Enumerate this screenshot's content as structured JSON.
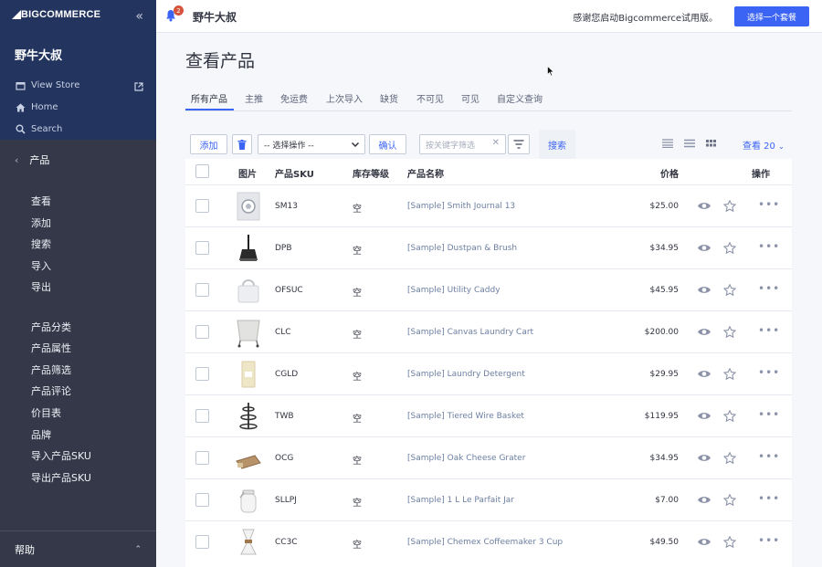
{
  "brand": {
    "logo_text": "BIGCOMMERCE",
    "accent": "#3c64f4",
    "sidebar_top": "#23355f",
    "sidebar_bg": "#343849"
  },
  "sidebar": {
    "store_name": "野牛大叔",
    "links": [
      {
        "label": "View Store",
        "icon": "storefront-icon"
      },
      {
        "label": "Home",
        "icon": "home-icon"
      },
      {
        "label": "Search",
        "icon": "search-icon"
      }
    ],
    "section": "产品",
    "items": [
      "查看",
      "添加",
      "搜索",
      "导入",
      "导出"
    ],
    "items2": [
      "产品分类",
      "产品属性",
      "产品筛选",
      "产品评论",
      "价目表",
      "品牌",
      "导入产品SKU",
      "导出产品SKU"
    ],
    "help": "帮助"
  },
  "topbar": {
    "notifications": "2",
    "store_name": "野牛大叔",
    "trial_text": "感谢您启动Bigcommerce试用版。",
    "plan_button": "选择一个套餐"
  },
  "page": {
    "title": "查看产品",
    "tabs": [
      "所有产品",
      "主推",
      "免运费",
      "上次导入",
      "缺货",
      "不可见",
      "可见",
      "自定义查询"
    ],
    "active_tab": "所有产品"
  },
  "toolbar": {
    "add": "添加",
    "select_action": "-- 选择操作 --",
    "confirm": "确认",
    "filter_placeholder": "按关键字筛选",
    "search": "搜索",
    "per_page": "查看 20"
  },
  "table": {
    "headers": {
      "image": "图片",
      "sku": "产品SKU",
      "stock": "库存等级",
      "name": "产品名称",
      "price": "价格",
      "actions": "操作"
    },
    "rows": [
      {
        "sku": "SM13",
        "stock": "空",
        "name": "[Sample] Smith Journal 13",
        "price": "$25.00",
        "image": "journal"
      },
      {
        "sku": "DPB",
        "stock": "空",
        "name": "[Sample] Dustpan & Brush",
        "price": "$34.95",
        "image": "dustpan"
      },
      {
        "sku": "OFSUC",
        "stock": "空",
        "name": "[Sample] Utility Caddy",
        "price": "$45.95",
        "image": "caddy"
      },
      {
        "sku": "CLC",
        "stock": "空",
        "name": "[Sample] Canvas Laundry Cart",
        "price": "$200.00",
        "image": "cart"
      },
      {
        "sku": "CGLD",
        "stock": "空",
        "name": "[Sample] Laundry Detergent",
        "price": "$29.95",
        "image": "detergent"
      },
      {
        "sku": "TWB",
        "stock": "空",
        "name": "[Sample] Tiered Wire Basket",
        "price": "$119.95",
        "image": "basket"
      },
      {
        "sku": "OCG",
        "stock": "空",
        "name": "[Sample] Oak Cheese Grater",
        "price": "$34.95",
        "image": "grater"
      },
      {
        "sku": "SLLPJ",
        "stock": "空",
        "name": "[Sample] 1 L Le Parfait Jar",
        "price": "$7.00",
        "image": "jar"
      },
      {
        "sku": "CC3C",
        "stock": "空",
        "name": "[Sample] Chemex Coffeemaker 3 Cup",
        "price": "$49.50",
        "image": "chemex"
      }
    ]
  }
}
